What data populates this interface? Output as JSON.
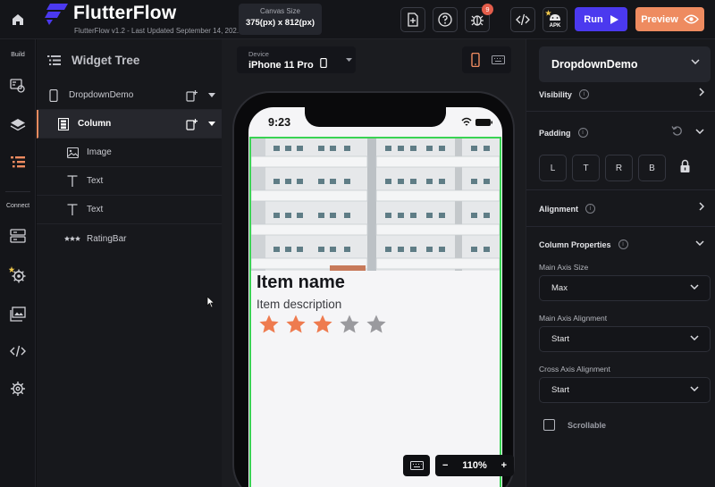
{
  "app": {
    "brand": "FlutterFlow",
    "version_line": "FlutterFlow v1.2 - Last Updated September 14, 202..."
  },
  "toolbar": {
    "canvas_size_label": "Canvas Size",
    "canvas_size_value": "375(px) x 812(px)",
    "bug_badge_count": "9",
    "apk_label": "APK",
    "run_label": "Run",
    "preview_label": "Preview"
  },
  "rail": {
    "build_label": "Build",
    "connect_label": "Connect"
  },
  "widget_tree": {
    "title": "Widget Tree",
    "items": [
      {
        "label": "DropdownDemo",
        "icon": "phone-icon"
      },
      {
        "label": "Column",
        "icon": "column-icon"
      },
      {
        "label": "Image",
        "icon": "image-icon"
      },
      {
        "label": "Text",
        "icon": "text-icon"
      },
      {
        "label": "Text",
        "icon": "text-icon"
      },
      {
        "label": "RatingBar",
        "icon": "rating-icon"
      }
    ]
  },
  "canvas": {
    "device_label": "Device",
    "device_value": "iPhone 11 Pro",
    "status_time": "9:23",
    "item_name": "Item name",
    "item_description": "Item description",
    "rating": {
      "value": 3,
      "max": 5,
      "active_color": "#ee7b4f",
      "inactive_color": "#9a9a9e"
    },
    "zoom_level": "110%",
    "zoom_minus": "−",
    "zoom_plus": "+"
  },
  "properties": {
    "widget_name": "DropdownDemo",
    "visibility_label": "Visibility",
    "padding_label": "Padding",
    "padding_boxes": [
      "L",
      "T",
      "R",
      "B"
    ],
    "alignment_label": "Alignment",
    "column_properties_label": "Column Properties",
    "main_axis_size_label": "Main Axis Size",
    "main_axis_size_value": "Max",
    "main_axis_alignment_label": "Main Axis Alignment",
    "main_axis_alignment_value": "Start",
    "cross_axis_alignment_label": "Cross Axis Alignment",
    "cross_axis_alignment_value": "Start",
    "scrollable_label": "Scrollable",
    "info_glyph": "i"
  },
  "colors": {
    "accent": "#ee8b60",
    "run": "#4b39ef",
    "selection_outline": "#39d353"
  }
}
